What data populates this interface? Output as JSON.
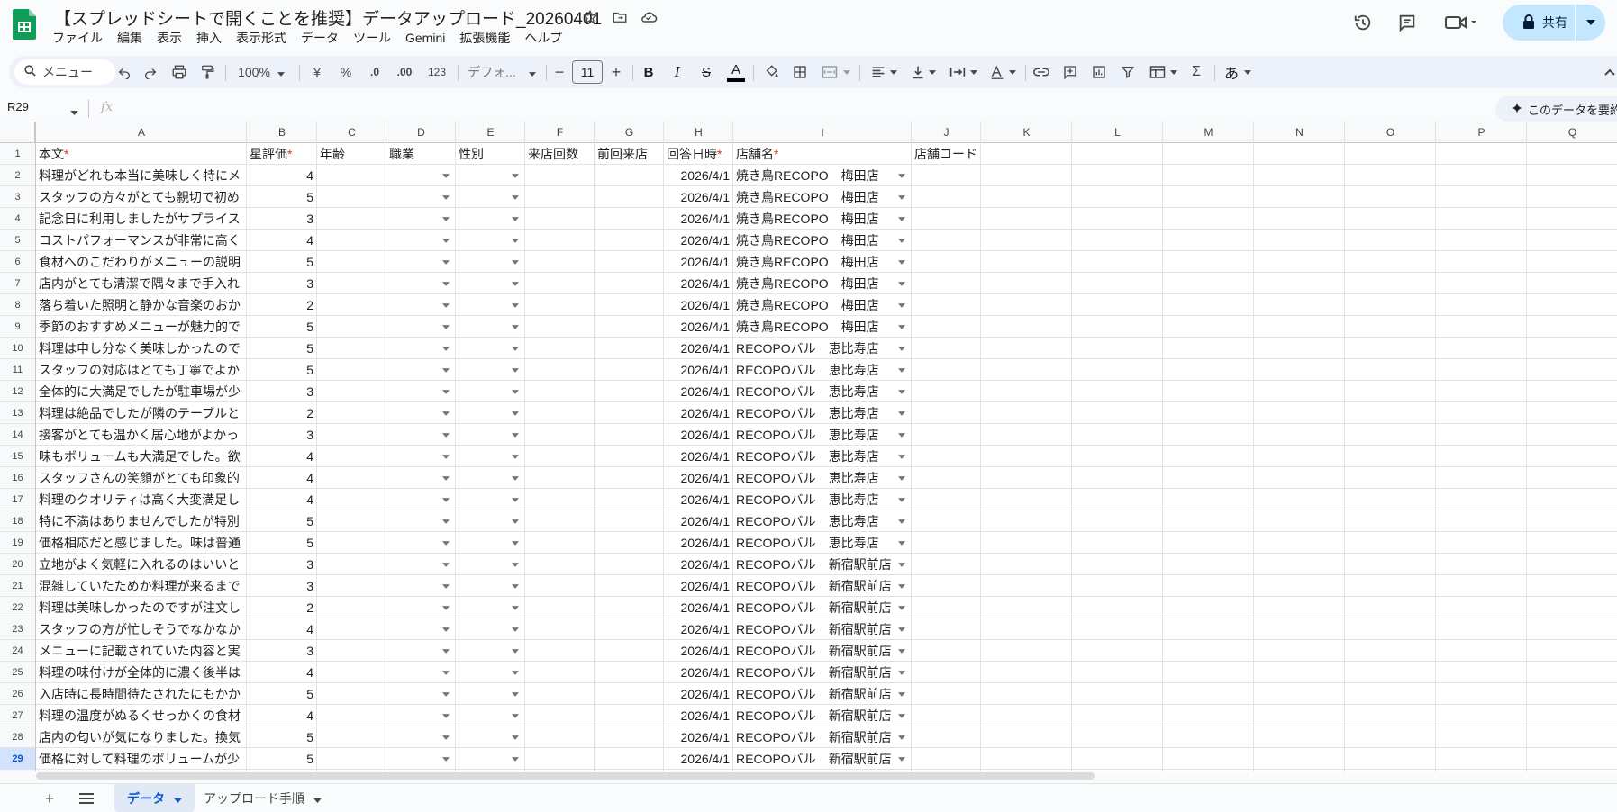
{
  "app": {
    "doc_title": "【スプレッドシートで開くことを推奨】データアップロード_20260401",
    "share_label": "共有"
  },
  "menu": [
    "ファイル",
    "編集",
    "表示",
    "挿入",
    "表示形式",
    "データ",
    "ツール",
    "Gemini",
    "拡張機能",
    "ヘルプ"
  ],
  "toolbar": {
    "search_placeholder": "メニュー",
    "zoom": "100%",
    "currency": "¥",
    "percent": "%",
    "dec_decrease": ".0",
    "dec_increase": ".00",
    "number_format": "123",
    "font_name": "デフォ...",
    "font_size": "11",
    "input_tools": "あ",
    "text_color": "#000000"
  },
  "formula_bar": {
    "cell_ref": "R29",
    "fx": "fx",
    "summarize_label": "このデータを要約"
  },
  "grid": {
    "columns": [
      "A",
      "B",
      "C",
      "D",
      "E",
      "F",
      "G",
      "H",
      "I",
      "J",
      "K",
      "L",
      "M",
      "N",
      "O",
      "P",
      "Q"
    ],
    "header_labels": [
      "本文",
      "星評価",
      "年齢",
      "職業",
      "性別",
      "来店回数",
      "前回来店",
      "回答日時",
      "店舗名",
      "店舗コード"
    ],
    "required_mark": "*",
    "selected_row": 29,
    "rows": [
      {
        "n": 2,
        "text": "料理がどれも本当に美味しく特にメ",
        "rating": 4,
        "date": "2026/4/1",
        "store": "焼き鳥RECOPO",
        "branch": "梅田店"
      },
      {
        "n": 3,
        "text": "スタッフの方々がとても親切で初め",
        "rating": 5,
        "date": "2026/4/1",
        "store": "焼き鳥RECOPO",
        "branch": "梅田店"
      },
      {
        "n": 4,
        "text": "記念日に利用しましたがサプライス",
        "rating": 3,
        "date": "2026/4/1",
        "store": "焼き鳥RECOPO",
        "branch": "梅田店"
      },
      {
        "n": 5,
        "text": "コストパフォーマンスが非常に高く",
        "rating": 4,
        "date": "2026/4/1",
        "store": "焼き鳥RECOPO",
        "branch": "梅田店"
      },
      {
        "n": 6,
        "text": "食材へのこだわりがメニューの説明",
        "rating": 5,
        "date": "2026/4/1",
        "store": "焼き鳥RECOPO",
        "branch": "梅田店"
      },
      {
        "n": 7,
        "text": "店内がとても清潔で隅々まで手入れ",
        "rating": 3,
        "date": "2026/4/1",
        "store": "焼き鳥RECOPO",
        "branch": "梅田店"
      },
      {
        "n": 8,
        "text": "落ち着いた照明と静かな音楽のおか",
        "rating": 2,
        "date": "2026/4/1",
        "store": "焼き鳥RECOPO",
        "branch": "梅田店"
      },
      {
        "n": 9,
        "text": "季節のおすすめメニューが魅力的で",
        "rating": 5,
        "date": "2026/4/1",
        "store": "焼き鳥RECOPO",
        "branch": "梅田店"
      },
      {
        "n": 10,
        "text": "料理は申し分なく美味しかったので",
        "rating": 5,
        "date": "2026/4/1",
        "store": "RECOPOバル",
        "branch": "恵比寿店"
      },
      {
        "n": 11,
        "text": "スタッフの対応はとても丁寧でよか",
        "rating": 5,
        "date": "2026/4/1",
        "store": "RECOPOバル",
        "branch": "恵比寿店"
      },
      {
        "n": 12,
        "text": "全体的に大満足でしたが駐車場が少",
        "rating": 3,
        "date": "2026/4/1",
        "store": "RECOPOバル",
        "branch": "恵比寿店"
      },
      {
        "n": 13,
        "text": "料理は絶品でしたが隣のテーブルと",
        "rating": 2,
        "date": "2026/4/1",
        "store": "RECOPOバル",
        "branch": "恵比寿店"
      },
      {
        "n": 14,
        "text": "接客がとても温かく居心地がよかっ",
        "rating": 3,
        "date": "2026/4/1",
        "store": "RECOPOバル",
        "branch": "恵比寿店"
      },
      {
        "n": 15,
        "text": "味もボリュームも大満足でした。欲",
        "rating": 4,
        "date": "2026/4/1",
        "store": "RECOPOバル",
        "branch": "恵比寿店"
      },
      {
        "n": 16,
        "text": "スタッフさんの笑顔がとても印象的",
        "rating": 4,
        "date": "2026/4/1",
        "store": "RECOPOバル",
        "branch": "恵比寿店"
      },
      {
        "n": 17,
        "text": "料理のクオリティは高く大変満足し",
        "rating": 4,
        "date": "2026/4/1",
        "store": "RECOPOバル",
        "branch": "恵比寿店"
      },
      {
        "n": 18,
        "text": "特に不満はありませんでしたが特別",
        "rating": 5,
        "date": "2026/4/1",
        "store": "RECOPOバル",
        "branch": "恵比寿店"
      },
      {
        "n": 19,
        "text": "価格相応だと感じました。味は普通",
        "rating": 5,
        "date": "2026/4/1",
        "store": "RECOPOバル",
        "branch": "恵比寿店"
      },
      {
        "n": 20,
        "text": "立地がよく気軽に入れるのはいいと",
        "rating": 3,
        "date": "2026/4/1",
        "store": "RECOPOバル",
        "branch": "新宿駅前店"
      },
      {
        "n": 21,
        "text": "混雑していたためか料理が来るまで",
        "rating": 3,
        "date": "2026/4/1",
        "store": "RECOPOバル",
        "branch": "新宿駅前店"
      },
      {
        "n": 22,
        "text": "料理は美味しかったのですが注文し",
        "rating": 2,
        "date": "2026/4/1",
        "store": "RECOPOバル",
        "branch": "新宿駅前店"
      },
      {
        "n": 23,
        "text": "スタッフの方が忙しそうでなかなか",
        "rating": 4,
        "date": "2026/4/1",
        "store": "RECOPOバル",
        "branch": "新宿駅前店"
      },
      {
        "n": 24,
        "text": "メニューに記載されていた内容と実",
        "rating": 3,
        "date": "2026/4/1",
        "store": "RECOPOバル",
        "branch": "新宿駅前店"
      },
      {
        "n": 25,
        "text": "料理の味付けが全体的に濃く後半は",
        "rating": 4,
        "date": "2026/4/1",
        "store": "RECOPOバル",
        "branch": "新宿駅前店"
      },
      {
        "n": 26,
        "text": "入店時に長時間待たされたにもかか",
        "rating": 5,
        "date": "2026/4/1",
        "store": "RECOPOバル",
        "branch": "新宿駅前店"
      },
      {
        "n": 27,
        "text": "料理の温度がぬるくせっかくの食材",
        "rating": 4,
        "date": "2026/4/1",
        "store": "RECOPOバル",
        "branch": "新宿駅前店"
      },
      {
        "n": 28,
        "text": "店内の匂いが気になりました。換気",
        "rating": 5,
        "date": "2026/4/1",
        "store": "RECOPOバル",
        "branch": "新宿駅前店"
      },
      {
        "n": 29,
        "text": "価格に対して料理のボリュームが少",
        "rating": 5,
        "date": "2026/4/1",
        "store": "RECOPOバル",
        "branch": "新宿駅前店"
      }
    ]
  },
  "sheets": {
    "tabs": [
      {
        "label": "データ",
        "active": true
      },
      {
        "label": "アップロード手順",
        "active": false
      }
    ]
  },
  "colors": {
    "accent": "#0b57d0",
    "share_bg": "#c2e7ff",
    "required": "#d93025",
    "sheets_green": "#0f9d58"
  }
}
